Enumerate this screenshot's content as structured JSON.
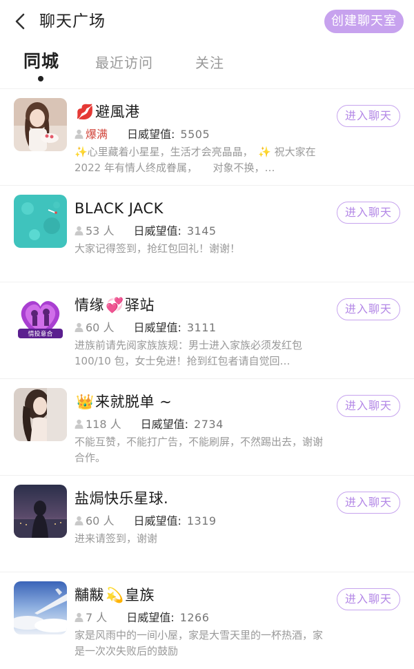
{
  "header": {
    "title": "聊天广场",
    "create_button": "创建聊天室"
  },
  "tabs": [
    {
      "label": "同城",
      "active": true
    },
    {
      "label": "最近访问",
      "active": false
    },
    {
      "label": "关注",
      "active": false
    }
  ],
  "colors": {
    "accent": "#c7a2ee",
    "full_count": "#d2473d"
  },
  "rooms": [
    {
      "name_prefix_icon": "💋",
      "name": "避風港",
      "name_suffix_icon": "",
      "member_count": "爆满",
      "prestige_label": "日威望值:",
      "prestige_value": "5505",
      "description": "✨心里藏着小星星，生活才会亮晶晶，　✨ 祝大家在 2022 年有情人终成眷属，　　对象不换，…",
      "join_label": "进入聊天"
    },
    {
      "name_prefix_icon": "",
      "name": "BLACK JACK",
      "name_suffix_icon": "",
      "member_count": "53 人",
      "prestige_label": "日威望值:",
      "prestige_value": "3145",
      "description": "大家记得签到，抢红包回礼！谢谢！",
      "join_label": "进入聊天"
    },
    {
      "name_prefix_icon": "",
      "name": "情缘",
      "name_middle_icon": "💞",
      "name_part2": "驿站",
      "member_count": "60 人",
      "prestige_label": "日威望值:",
      "prestige_value": "3111",
      "description": "进族前请先阅家族族规：男士进入家族必须发红包 100/10 包，女士免进！抢到红包者请自觉回…",
      "join_label": "进入聊天",
      "avatar_banner": "情投意合"
    },
    {
      "name_prefix_icon": "👑",
      "name": "来就脱单 ~",
      "member_count": "118 人",
      "prestige_label": "日威望值:",
      "prestige_value": "2734",
      "description": "不能互赞，不能打广告，不能刷屏，不然踢出去，谢谢合作。",
      "join_label": "进入聊天"
    },
    {
      "name_prefix_icon": "",
      "name": "盐焗快乐星球.",
      "member_count": "60 人",
      "prestige_label": "日威望值:",
      "prestige_value": "1319",
      "description": "进来请签到，谢谢",
      "join_label": "进入聊天"
    },
    {
      "name_prefix_icon": "",
      "name": "黼黻",
      "name_middle_icon": "💫",
      "name_part2": "皇族",
      "member_count": "7 人",
      "prestige_label": "日威望值:",
      "prestige_value": "1266",
      "description": "家是风雨中的一间小屋，家是大雪天里的一杯热酒，家是一次次失败后的鼓励",
      "join_label": "进入聊天"
    }
  ]
}
